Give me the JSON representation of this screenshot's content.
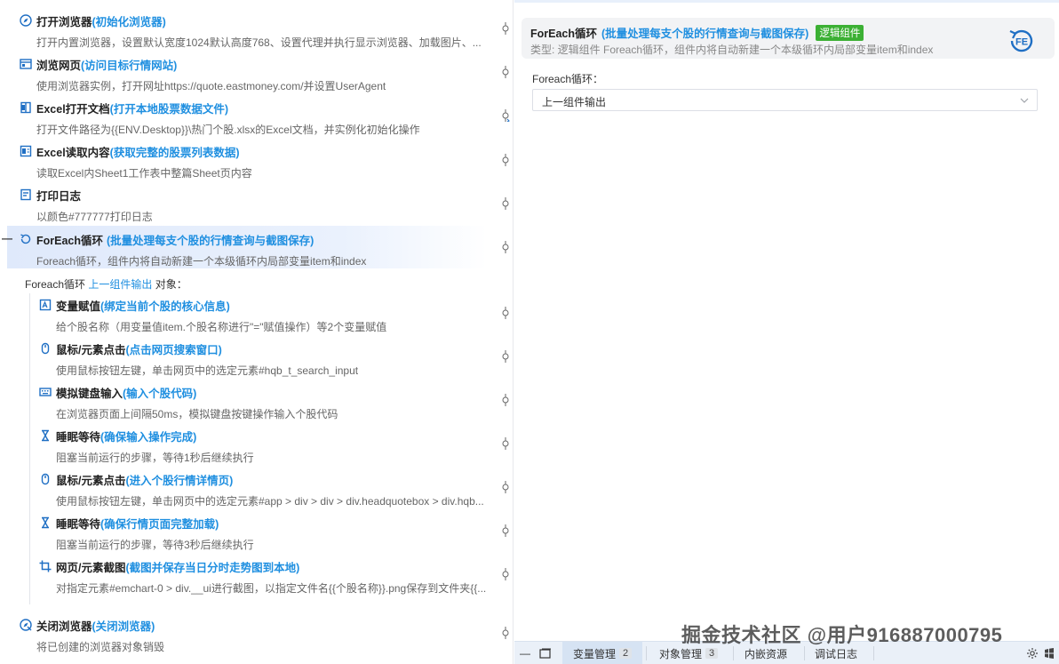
{
  "flow": {
    "steps": [
      {
        "title": "打开浏览器",
        "sub": "(初始化浏览器)",
        "desc": "打开内置浏览器，设置默认宽度1024默认高度768、设置代理并执行显示浏览器、加载图片、..."
      },
      {
        "title": "浏览网页",
        "sub": "(访问目标行情网站)",
        "desc": "使用浏览器实例，打开网址https://quote.eastmoney.com/并设置UserAgent"
      },
      {
        "title": "Excel打开文档",
        "sub": "(打开本地股票数据文件)",
        "desc": "打开文件路径为{{ENV.Desktop}}\\热门个股.xlsx的Excel文档，并实例化初始化操作"
      },
      {
        "title": "Excel读取内容",
        "sub": "(获取完整的股票列表数据)",
        "desc": "读取Excel内Sheet1工作表中整篇Sheet页内容"
      },
      {
        "title": "打印日志",
        "sub": "",
        "desc": "以颜色#777777打印日志"
      },
      {
        "title": "ForEach循环",
        "sub": "(批量处理每支个股的行情查询与截图保存)",
        "desc": "Foreach循环，组件内将自动新建一个本级循环内局部变量item和index"
      }
    ],
    "collapse_symbol": "—",
    "loop_line": {
      "prefix": "Foreach循环",
      "link": "上一组件输出",
      "suffix": "对象："
    },
    "nested_steps": [
      {
        "title": "变量赋值",
        "sub": "(绑定当前个股的核心信息)",
        "desc": "给个股名称（用变量值item.个股名称进行\"=\"赋值操作）等2个变量赋值"
      },
      {
        "title": "鼠标/元素点击",
        "sub": "(点击网页搜索窗口)",
        "desc": "使用鼠标按钮左键，单击网页中的选定元素#hqb_t_search_input"
      },
      {
        "title": "模拟键盘输入",
        "sub": "(输入个股代码)",
        "desc": "在浏览器页面上间隔50ms，模拟键盘按键操作输入个股代码"
      },
      {
        "title": "睡眠等待",
        "sub": "(确保输入操作完成)",
        "desc": "阻塞当前运行的步骤，等待1秒后继续执行"
      },
      {
        "title": "鼠标/元素点击",
        "sub": "(进入个股行情详情页)",
        "desc": "使用鼠标按钮左键，单击网页中的选定元素#app > div > div > div.headquotebox > div.hqb..."
      },
      {
        "title": "睡眠等待",
        "sub": "(确保行情页面完整加载)",
        "desc": "阻塞当前运行的步骤，等待3秒后继续执行"
      },
      {
        "title": "网页/元素截图",
        "sub": "(截图并保存当日分时走势图到本地)",
        "desc": "对指定元素#emchart-0 > div.__ui进行截图，以指定文件名{{个股名称}}.png保存到文件夹{{..."
      }
    ],
    "last_step": {
      "title": "关闭浏览器",
      "sub": "(关闭浏览器)",
      "desc": "将已创建的浏览器对象销毁"
    }
  },
  "props": {
    "title": "ForEach循环",
    "sub": "(批量处理每支个股的行情查询与截图保存)",
    "badge": "逻辑组件",
    "desc": "类型:   逻辑组件 Foreach循环，组件内将自动新建一个本级循环内局部变量item和index",
    "field_label": "Foreach循环：",
    "field_value": "上一组件输出"
  },
  "bottombar": {
    "minimize": "—",
    "tabs": [
      {
        "label": "变量管理",
        "count": "2"
      },
      {
        "label": "对象管理",
        "count": "3"
      },
      {
        "label": "内嵌资源",
        "count": ""
      },
      {
        "label": "调试日志",
        "count": ""
      }
    ]
  },
  "watermark": "掘金技术社区 @用户916887000795"
}
